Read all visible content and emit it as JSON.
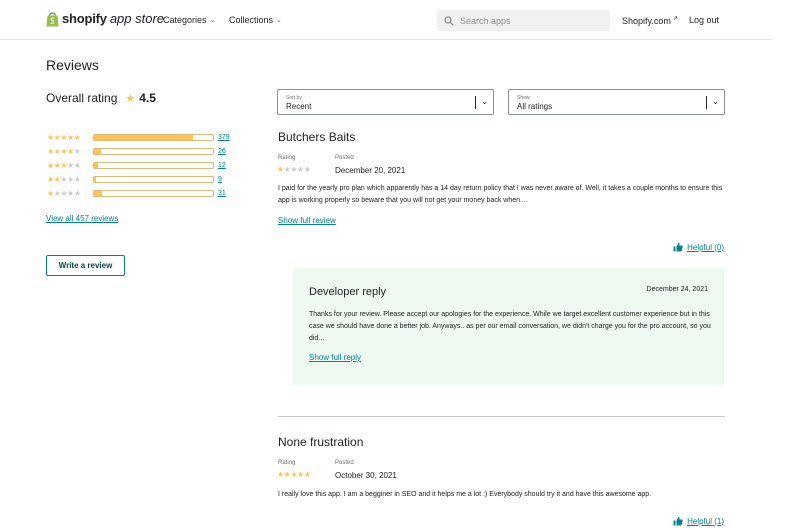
{
  "header": {
    "logo_brand": "shopify",
    "logo_sub": "app store",
    "nav": [
      {
        "label": "Categories",
        "icon": "chevron-down-icon"
      },
      {
        "label": "Collections",
        "icon": "chevron-down-icon"
      }
    ],
    "search_placeholder": "Search apps",
    "shopify_link": "Shopify.com",
    "logout": "Log out"
  },
  "reviews_page": {
    "title": "Reviews",
    "overall_label": "Overall rating",
    "overall_value": "4.5",
    "distribution": [
      {
        "stars": 5,
        "count": "379",
        "fraction": 0.83
      },
      {
        "stars": 4,
        "count": "26",
        "fraction": 0.06
      },
      {
        "stars": 3,
        "count": "12",
        "fraction": 0.03
      },
      {
        "stars": 2,
        "count": "9",
        "fraction": 0.02
      },
      {
        "stars": 1,
        "count": "31",
        "fraction": 0.07
      }
    ],
    "view_all": "View all 457 reviews",
    "write_review": "Write a review"
  },
  "filters": {
    "sort_label": "Sort by",
    "sort_value": "Recent",
    "show_label": "Show",
    "show_value": "All ratings"
  },
  "reviews": [
    {
      "name": "Butchers Baits",
      "rating_label": "Rating",
      "posted_label": "Posted",
      "rating": 1,
      "date": "December 20, 2021",
      "body": "I paid for the yearly pro plan which apparently has a 14 day return policy that I was never aware of. Well, it takes a couple months to ensure this app is working properly so beware that you will not get your money back when....",
      "show_full": "Show full review",
      "helpful": "Helpful (0)",
      "developer_reply": {
        "title": "Developer reply",
        "date": "December 24, 2021",
        "body": "Thanks for your review. Please accept our apologies for the experience. While we target excellent customer experience but in this case we should have done a better job. Anyways.. as per our email conversation, we didn't charge you for the pro account, so you did...",
        "show_full": "Show full reply"
      }
    },
    {
      "name": "None frustration",
      "rating_label": "Rating",
      "posted_label": "Posted",
      "rating": 5,
      "date": "October 30, 2021",
      "body": "I really love this app. I am a begginer in SEO and it helps me a lot :) Everybody should try it and have this awesome app.",
      "helpful": "Helpful (1)"
    }
  ],
  "colors": {
    "star": "#ffc453",
    "star_empty": "#c9cccf",
    "link": "#00848e",
    "reply_bg": "#eefaf1"
  }
}
